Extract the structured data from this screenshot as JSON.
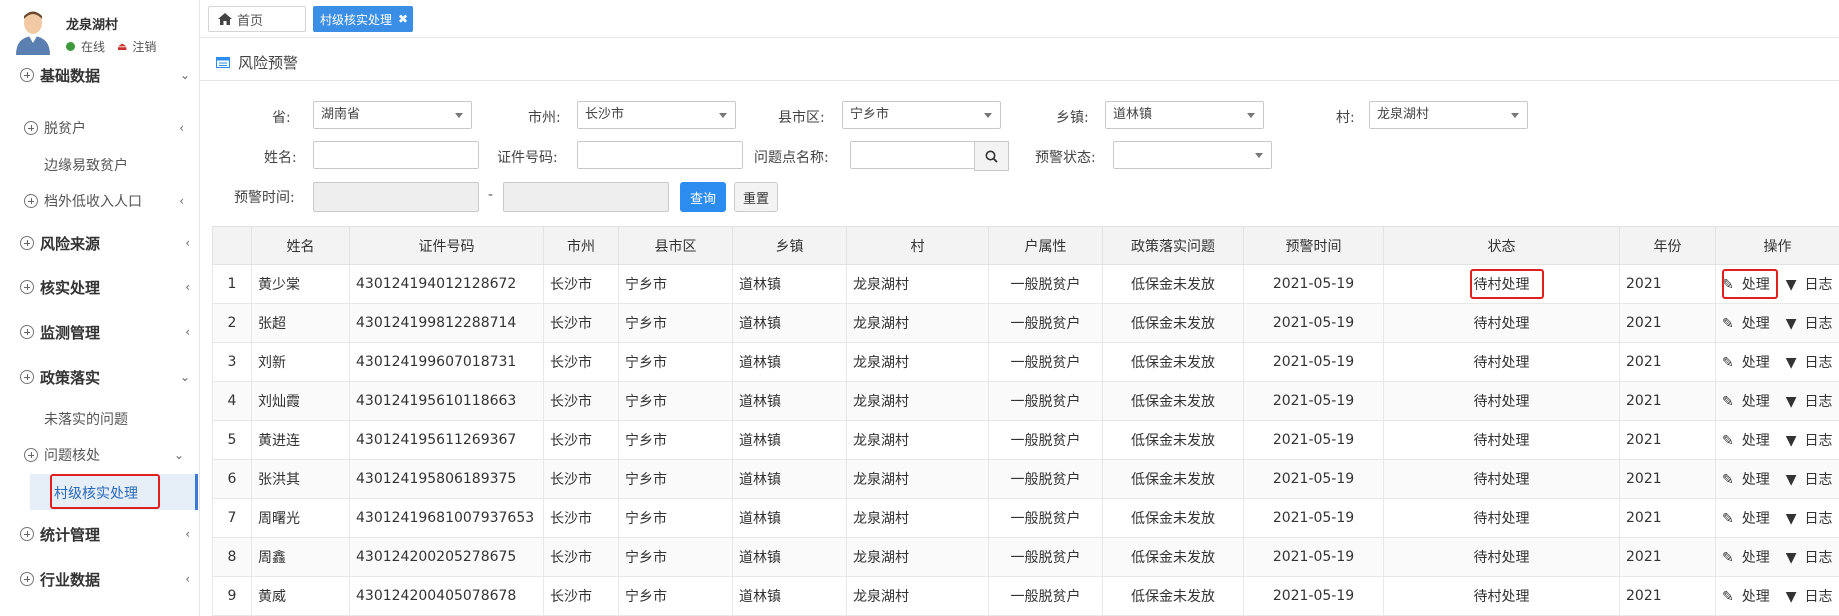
{
  "user": {
    "name": "龙泉湖村",
    "status": "在线",
    "logout": "注销"
  },
  "sidebar": {
    "groups": [
      {
        "label": "基础数据",
        "caret": "⌄"
      },
      {
        "label": "风险来源",
        "caret": "‹"
      },
      {
        "label": "核实处理",
        "caret": "‹"
      },
      {
        "label": "监测管理",
        "caret": "‹"
      },
      {
        "label": "政策落实",
        "caret": "⌄"
      },
      {
        "label": "统计管理",
        "caret": "‹"
      },
      {
        "label": "行业数据",
        "caret": "‹"
      }
    ],
    "subs": [
      {
        "label": "脱贫户",
        "caret": "‹"
      },
      {
        "label": "档外低收入人口",
        "caret": "‹"
      },
      {
        "label": "问题核处",
        "caret": "⌄"
      }
    ],
    "leaves": [
      "边缘易致贫户",
      "未落实的问题"
    ],
    "active": "村级核实处理"
  },
  "tabs": {
    "home": "首页",
    "current": "村级核实处理"
  },
  "panel_title": "风险预警",
  "form": {
    "province_label": "省:",
    "province": "湖南省",
    "city_label": "市州:",
    "city": "长沙市",
    "county_label": "县市区:",
    "county": "宁乡市",
    "town_label": "乡镇:",
    "town": "道林镇",
    "village_label": "村:",
    "village": "龙泉湖村",
    "name_label": "姓名:",
    "id_label": "证件号码:",
    "issue_label": "问题点名称:",
    "warn_status_label": "预警状态:",
    "warn_time_label": "预警时间:",
    "dash": "-",
    "query_btn": "查询",
    "reset_btn": "重置"
  },
  "table": {
    "headers": [
      "",
      "姓名",
      "证件号码",
      "市州",
      "县市区",
      "乡镇",
      "村",
      "户属性",
      "政策落实问题",
      "预警时间",
      "状态",
      "年份",
      "操作"
    ],
    "rows": [
      [
        "1",
        "黄少棠",
        "430124194012128672",
        "长沙市",
        "宁乡市",
        "道林镇",
        "龙泉湖村",
        "一般脱贫户",
        "低保金未发放",
        "2021-05-19",
        "待村处理",
        "2021"
      ],
      [
        "2",
        "张超",
        "430124199812288714",
        "长沙市",
        "宁乡市",
        "道林镇",
        "龙泉湖村",
        "一般脱贫户",
        "低保金未发放",
        "2021-05-19",
        "待村处理",
        "2021"
      ],
      [
        "3",
        "刘新",
        "430124199607018731",
        "长沙市",
        "宁乡市",
        "道林镇",
        "龙泉湖村",
        "一般脱贫户",
        "低保金未发放",
        "2021-05-19",
        "待村处理",
        "2021"
      ],
      [
        "4",
        "刘灿霞",
        "430124195610118663",
        "长沙市",
        "宁乡市",
        "道林镇",
        "龙泉湖村",
        "一般脱贫户",
        "低保金未发放",
        "2021-05-19",
        "待村处理",
        "2021"
      ],
      [
        "5",
        "黄进连",
        "430124195611269367",
        "长沙市",
        "宁乡市",
        "道林镇",
        "龙泉湖村",
        "一般脱贫户",
        "低保金未发放",
        "2021-05-19",
        "待村处理",
        "2021"
      ],
      [
        "6",
        "张洪其",
        "430124195806189375",
        "长沙市",
        "宁乡市",
        "道林镇",
        "龙泉湖村",
        "一般脱贫户",
        "低保金未发放",
        "2021-05-19",
        "待村处理",
        "2021"
      ],
      [
        "7",
        "周曙光",
        "43012419681007937653",
        "长沙市",
        "宁乡市",
        "道林镇",
        "龙泉湖村",
        "一般脱贫户",
        "低保金未发放",
        "2021-05-19",
        "待村处理",
        "2021"
      ],
      [
        "8",
        "周鑫",
        "430124200205278675",
        "长沙市",
        "宁乡市",
        "道林镇",
        "龙泉湖村",
        "一般脱贫户",
        "低保金未发放",
        "2021-05-19",
        "待村处理",
        "2021"
      ],
      [
        "9",
        "黄威",
        "430124200405078678",
        "长沙市",
        "宁乡市",
        "道林镇",
        "龙泉湖村",
        "一般脱贫户",
        "低保金未发放",
        "2021-05-19",
        "待村处理",
        "2021"
      ]
    ],
    "op_process": "处理",
    "op_log": "日志"
  }
}
